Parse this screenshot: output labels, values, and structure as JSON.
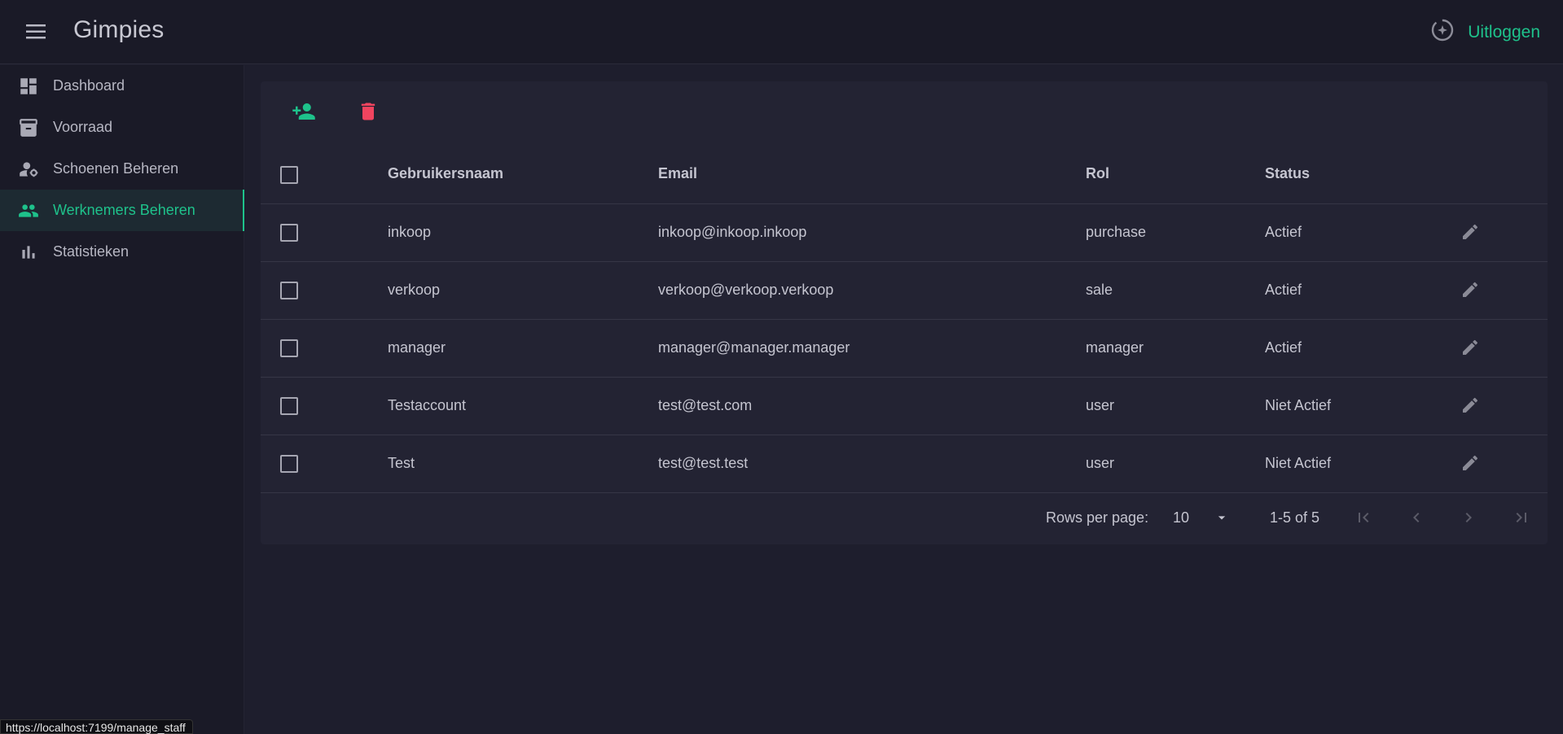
{
  "app": {
    "title": "Gimpies",
    "logout_label": "Uitloggen"
  },
  "sidebar": {
    "items": [
      {
        "label": "Dashboard",
        "icon": "dashboard-icon"
      },
      {
        "label": "Voorraad",
        "icon": "archive-icon"
      },
      {
        "label": "Schoenen Beheren",
        "icon": "manage-accounts-icon"
      },
      {
        "label": "Werknemers Beheren",
        "icon": "people-icon",
        "active": true
      },
      {
        "label": "Statistieken",
        "icon": "bar-chart-icon"
      }
    ]
  },
  "table": {
    "columns": [
      "Gebruikersnaam",
      "Email",
      "Rol",
      "Status"
    ],
    "rows": [
      {
        "username": "inkoop",
        "email": "inkoop@inkoop.inkoop",
        "role": "purchase",
        "status": "Actief"
      },
      {
        "username": "verkoop",
        "email": "verkoop@verkoop.verkoop",
        "role": "sale",
        "status": "Actief"
      },
      {
        "username": "manager",
        "email": "manager@manager.manager",
        "role": "manager",
        "status": "Actief"
      },
      {
        "username": "Testaccount",
        "email": "test@test.com",
        "role": "user",
        "status": "Niet Actief"
      },
      {
        "username": "Test",
        "email": "test@test.test",
        "role": "user",
        "status": "Niet Actief"
      }
    ]
  },
  "pagination": {
    "rows_per_page_label": "Rows per page:",
    "rows_per_page": "10",
    "range": "1-5 of 5"
  },
  "statusbar": {
    "url": "https://localhost:7199/manage_staff"
  },
  "colors": {
    "accent": "#1ec28b",
    "danger": "#f0445f",
    "background": "#1e1e2d",
    "surface": "#232333"
  }
}
